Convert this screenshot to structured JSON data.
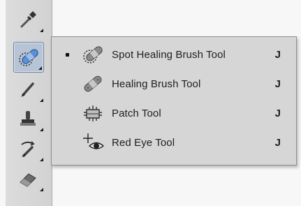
{
  "toolbar": {
    "tools": [
      {
        "name": "eyedropper-icon"
      },
      {
        "name": "spot-healing-brush-icon",
        "active": true
      },
      {
        "name": "brush-icon"
      },
      {
        "name": "clone-stamp-icon"
      },
      {
        "name": "history-brush-icon"
      },
      {
        "name": "eraser-icon"
      }
    ]
  },
  "flyout": {
    "items": [
      {
        "label": "Spot Healing Brush Tool",
        "shortcut": "J",
        "selected": true,
        "icon": "spot-healing-brush-icon"
      },
      {
        "label": "Healing Brush Tool",
        "shortcut": "J",
        "selected": false,
        "icon": "healing-brush-icon"
      },
      {
        "label": "Patch Tool",
        "shortcut": "J",
        "selected": false,
        "icon": "patch-icon"
      },
      {
        "label": "Red Eye Tool",
        "shortcut": "J",
        "selected": false,
        "icon": "red-eye-icon"
      }
    ]
  },
  "colors": {
    "active_tool_bg": "#b7c4d6",
    "bandage": "#5b8fd6",
    "menu_bg": "#d6d6d6"
  }
}
